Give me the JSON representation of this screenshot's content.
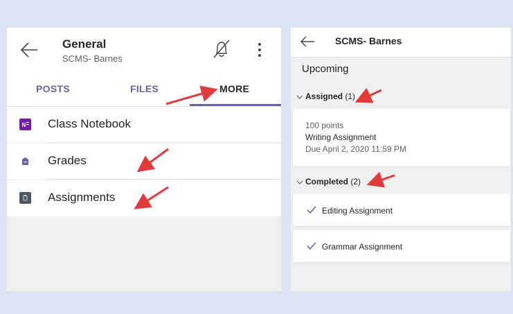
{
  "left": {
    "title": "General",
    "subtitle": "SCMS- Barnes",
    "tabs": [
      {
        "label": "POSTS"
      },
      {
        "label": "FILES"
      },
      {
        "label": "MORE"
      }
    ],
    "items": [
      {
        "label": "Class Notebook",
        "icon": "notebook-icon"
      },
      {
        "label": "Grades",
        "icon": "grades-icon"
      },
      {
        "label": "Assignments",
        "icon": "assignments-icon"
      }
    ]
  },
  "right": {
    "title": "SCMS- Barnes",
    "upcoming": "Upcoming",
    "assigned": {
      "label": "Assigned",
      "count": "(1)"
    },
    "assignment": {
      "points": "100 points",
      "name": "Writing Assignment",
      "due": "Due April 2, 2020 11:59 PM"
    },
    "completed": {
      "label": "Completed",
      "count": "(2)"
    },
    "completed_items": [
      {
        "label": "Editing Assignment"
      },
      {
        "label": "Grammar Assignment"
      }
    ]
  },
  "colors": {
    "accent": "#6264a7",
    "annotation_arrow": "#e03a3a",
    "onenote": "#7719aa",
    "assignments_icon": "#4b5563"
  }
}
